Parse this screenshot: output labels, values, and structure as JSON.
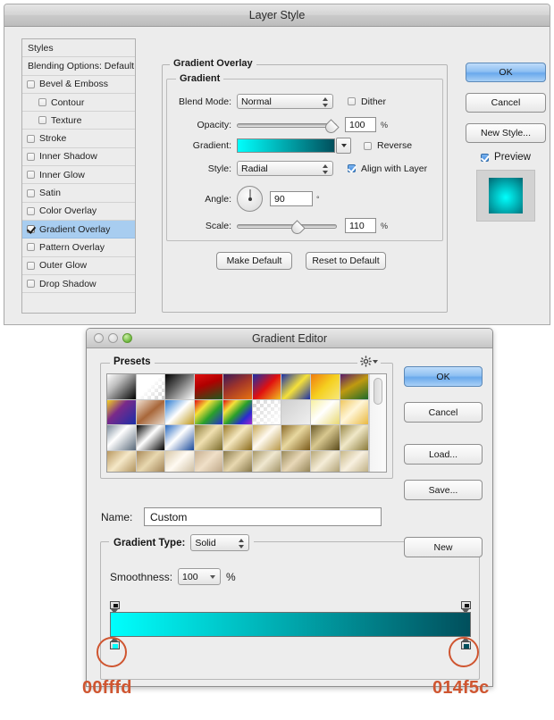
{
  "layer_style": {
    "title": "Layer Style",
    "sidebar": [
      {
        "label": "Styles",
        "type": "header"
      },
      {
        "label": "Blending Options: Default",
        "type": "header"
      },
      {
        "label": "Bevel & Emboss",
        "type": "check",
        "checked": false,
        "indent": false
      },
      {
        "label": "Contour",
        "type": "check",
        "checked": false,
        "indent": true
      },
      {
        "label": "Texture",
        "type": "check",
        "checked": false,
        "indent": true
      },
      {
        "label": "Stroke",
        "type": "check",
        "checked": false,
        "indent": false
      },
      {
        "label": "Inner Shadow",
        "type": "check",
        "checked": false,
        "indent": false
      },
      {
        "label": "Inner Glow",
        "type": "check",
        "checked": false,
        "indent": false
      },
      {
        "label": "Satin",
        "type": "check",
        "checked": false,
        "indent": false
      },
      {
        "label": "Color Overlay",
        "type": "check",
        "checked": false,
        "indent": false
      },
      {
        "label": "Gradient Overlay",
        "type": "check",
        "checked": true,
        "indent": false,
        "selected": true
      },
      {
        "label": "Pattern Overlay",
        "type": "check",
        "checked": false,
        "indent": false
      },
      {
        "label": "Outer Glow",
        "type": "check",
        "checked": false,
        "indent": false
      },
      {
        "label": "Drop Shadow",
        "type": "check",
        "checked": false,
        "indent": false
      }
    ],
    "panel": {
      "group_title": "Gradient Overlay",
      "subgroup_title": "Gradient",
      "blend_mode_label": "Blend Mode:",
      "blend_mode_value": "Normal",
      "dither_label": "Dither",
      "dither_checked": false,
      "opacity_label": "Opacity:",
      "opacity_value": "100",
      "opacity_unit": "%",
      "opacity_percent": 100,
      "gradient_label": "Gradient:",
      "reverse_label": "Reverse",
      "reverse_checked": false,
      "style_label": "Style:",
      "style_value": "Radial",
      "align_label": "Align with Layer",
      "align_checked": true,
      "angle_label": "Angle:",
      "angle_value": "90",
      "angle_unit": "°",
      "scale_label": "Scale:",
      "scale_value": "110",
      "scale_unit": "%",
      "scale_percent": 62,
      "make_default": "Make Default",
      "reset_to_default": "Reset to Default"
    },
    "right_buttons": {
      "ok": "OK",
      "cancel": "Cancel",
      "new_style": "New Style...",
      "preview_label": "Preview",
      "preview_checked": true
    }
  },
  "gradient_editor": {
    "title": "Gradient Editor",
    "window_controls": [
      "close-button",
      "minimize-button",
      "zoom-button"
    ],
    "presets_label": "Presets",
    "gear_icon": "gear-icon",
    "name_label": "Name:",
    "name_value": "Custom",
    "new_button": "New",
    "gradient_type_label": "Gradient Type:",
    "gradient_type_value": "Solid",
    "smoothness_label": "Smoothness:",
    "smoothness_value": "100",
    "smoothness_unit": "%",
    "buttons": {
      "ok": "OK",
      "cancel": "Cancel",
      "load": "Load...",
      "save": "Save..."
    },
    "presets": [
      "linear-gradient(135deg,#ffffff 0%,#bdbdbd 35%,#000000 100%)",
      "linear-gradient(135deg,#ffffff 0%,#ffffff 45%,rgba(255,255,255,0) 100%)",
      "linear-gradient(135deg,#000000 0%,#6a6a6a 45%,#ffffff 100%)",
      "linear-gradient(160deg,#e01010 0%,#b00000 40%,#1d5a1d 100%)",
      "linear-gradient(150deg,#3a1a5a 0%,#a0342a 45%,#e8720f 100%)",
      "linear-gradient(135deg,#1a2ea8 0%,#e01010 50%,#f0c020 100%)",
      "linear-gradient(135deg,#1a2ea8 0%,#f5e13a 50%,#1a2ea8 100%)",
      "linear-gradient(135deg,#f07c10 0%,#f5d020 50%,#f7e87a 100%)",
      "linear-gradient(150deg,#5a1a6a 0%,#c09a10 45%,#1d6a2a 100%)",
      "linear-gradient(135deg,#f5d020 0%,#7a2a8a 40%,#1a2ea8 100%)",
      "linear-gradient(140deg,#f0e0d0 0%,#a8673a 50%,#e8d8c8 100%)",
      "linear-gradient(135deg,#2a7ad0 0%,#ffffff 48%,#c09a20 100%)",
      "linear-gradient(135deg,#e01010 0%,#f5e13a 30%,#2aa02a 60%,#2a2ad0 100%)",
      "linear-gradient(135deg,#e01010 0%,#f5e13a 25%,#2aa02a 50%,#2a2ad0 75%,#a02ad0 100%)",
      "linear-gradient(135deg,rgba(255,255,255,0.1) 0%,#ffffff 100%)",
      "linear-gradient(135deg,#cfcfcf 0%,#efefef 100%)",
      "linear-gradient(135deg,#f7f0a0 0%,#ffffff 45%,#e8d870 100%)",
      "linear-gradient(135deg,#f0c860 0%,#fff6d8 45%,#e8b840 100%)",
      "linear-gradient(135deg,#7a8a9a 0%,#ffffff 40%,#5a6a7a 100%)",
      "linear-gradient(135deg,#000000 0%,#ffffff 45%,#000000 100%)",
      "linear-gradient(135deg,#2a6ac0 0%,#ffffff 45%,#1a4a9a 100%)",
      "linear-gradient(135deg,#8a7a3a 0%,#f0e0b0 45%,#7a6a2a 100%)",
      "linear-gradient(135deg,#9a7a2a 0%,#f5e8c0 45%,#8a6a1a 100%)",
      "linear-gradient(135deg,#c8a858 0%,#fffaf0 45%,#b89848 100%)",
      "linear-gradient(135deg,#8a6a2a 0%,#e8d8a0 45%,#7a5a1a 100%)",
      "linear-gradient(135deg,#6a5a2a 0%,#d8c890 45%,#5a4a1a 100%)",
      "linear-gradient(135deg,#9a8a4a 0%,#f0e8c8 45%,#8a7a3a 100%)",
      "linear-gradient(135deg,#b89860 0%,#f5e8c8 45%,#a88850 100%)",
      "linear-gradient(135deg,#a88858 0%,#e8d8b0 45%,#98784a 100%)",
      "linear-gradient(135deg,#d8c8a8 0%,#fffaf2 45%,#c8b898 100%)",
      "linear-gradient(135deg,#c8b090 0%,#f0e0c8 45%,#b8a080 100%)",
      "linear-gradient(135deg,#8a7a4a 0%,#e8d8b0 45%,#7a6a3a 100%)",
      "linear-gradient(135deg,#a89868 0%,#f0e8d0 45%,#988858 100%)",
      "linear-gradient(135deg,#9a8a5a 0%,#e8d8b8 45%,#8a7a4a 100%)",
      "linear-gradient(135deg,#b8a878 0%,#f5edd8 45%,#a89868 100%)",
      "linear-gradient(135deg,#c8b888 0%,#f8f0e0 45%,#b8a878 100%)"
    ],
    "gradient_bar": {
      "from_color": "#00fffd",
      "to_color": "#014f5c",
      "stops": [
        {
          "position": 0,
          "color": "#00fffd"
        },
        {
          "position": 100,
          "color": "#014f5c"
        }
      ]
    }
  },
  "annotations": {
    "color": "#cf5530",
    "left_hex": "00fffd",
    "right_hex": "014f5c"
  }
}
